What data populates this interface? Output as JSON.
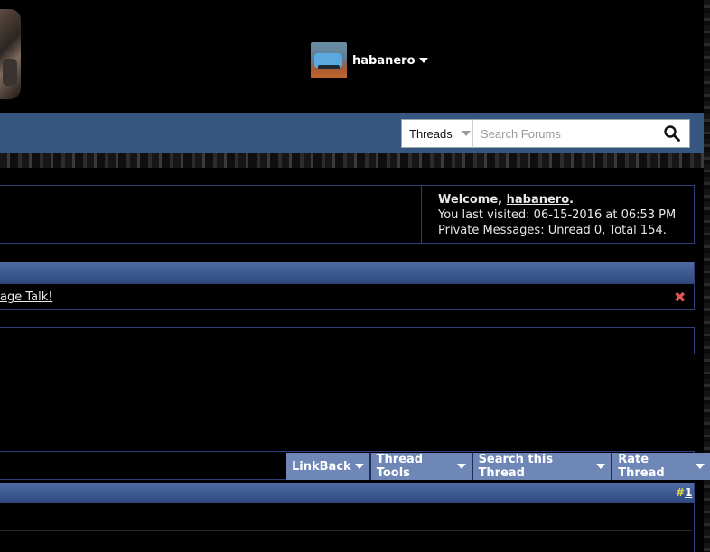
{
  "header": {
    "username": "habanero"
  },
  "nav": {
    "search_scope": "Threads",
    "search_placeholder": "Search Forums"
  },
  "welcome": {
    "welcome_prefix": "Welcome, ",
    "welcome_user": "habanero",
    "welcome_suffix": ".",
    "last_visited_prefix": "You last visited: ",
    "last_visited_date": "06-15-2016",
    "last_visited_at": " at ",
    "last_visited_time": "06:53 PM",
    "pm_link": "Private Messages",
    "pm_status": ": Unread 0, Total 154."
  },
  "notice": {
    "link_text": "age Talk!"
  },
  "thread_controls": {
    "buttons": [
      {
        "label": "LinkBack"
      },
      {
        "label": "Thread Tools"
      },
      {
        "label": "Search this Thread"
      },
      {
        "label": "Rate Thread"
      }
    ]
  },
  "post": {
    "number_prefix": "#",
    "number": "1"
  },
  "colors": {
    "navbar": "#36557f",
    "accent_blue": "#2e3f7a",
    "button_blue": "#6f87b7",
    "close_red": "#e05555"
  },
  "icons": {
    "search": "search-icon",
    "close": "close-icon",
    "dropdown": "chevron-down-icon"
  }
}
